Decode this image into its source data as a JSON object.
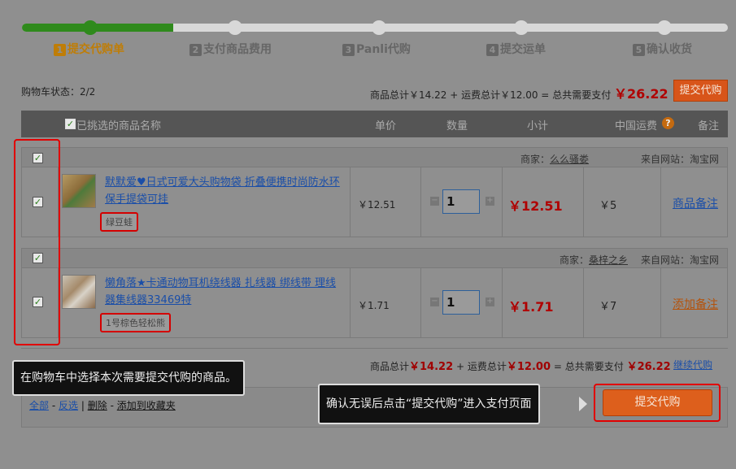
{
  "steps": [
    {
      "num": "1",
      "label": "提交代购单",
      "active": true
    },
    {
      "num": "2",
      "label": "支付商品费用",
      "active": false
    },
    {
      "num": "3",
      "label": "Panli代购",
      "active": false
    },
    {
      "num": "4",
      "label": "提交运单",
      "active": false
    },
    {
      "num": "5",
      "label": "确认收货",
      "active": false
    }
  ],
  "cart_status": "购物车状态：2/2",
  "summary": {
    "goods_label": "商品总计",
    "goods_total": "￥14.22",
    "plus": "+",
    "shipping_label": "运费总计",
    "shipping_total": "￥12.00",
    "eq": "=",
    "pay_label": "总共需要支付",
    "pay_total_top": "￥26.22",
    "pay_total_bottom": "￥26.22"
  },
  "submit_label": "提交代购",
  "table_headers": {
    "name": "已挑选的商品名称",
    "unit_price": "单价",
    "quantity": "数量",
    "subtotal": "小计",
    "cn_shipping": "中国运费",
    "help": "?",
    "note": "备注"
  },
  "items": [
    {
      "seller_label": "商家：",
      "seller": "么么骚娄",
      "site_label": "来自网站：",
      "site": "淘宝网",
      "title": "默默爱♥日式可爱大头购物袋 折叠便携时尚防水环保手提袋可挂",
      "spec": "绿豆蛙",
      "unit_price": "￥12.51",
      "qty": "1",
      "subtotal": "￥12.51",
      "shipping": "￥5",
      "note_action": "商品备注"
    },
    {
      "seller_label": "商家：",
      "seller": "桑梓之乡",
      "site_label": "来自网站：",
      "site": "淘宝网",
      "title": "懒角落★卡通动物耳机绕线器 扎线器 绑线带 理线器集线器33469特",
      "spec": "1号棕色轻松熊",
      "unit_price": "￥1.71",
      "qty": "1",
      "subtotal": "￥1.71",
      "shipping": "￥7",
      "note_action": "添加备注"
    }
  ],
  "continue_label": "继续代购",
  "bottom_actions": {
    "all": "全部",
    "sep1": "-",
    "invert": "反选",
    "sep2": "|",
    "delete": "删除",
    "sep3": "-",
    "favorite": "添加到收藏夹"
  },
  "callouts": {
    "select_tip": "在购物车中选择本次需要提交代购的商品。",
    "submit_tip": "确认无误后点击“提交代购”进入支付页面"
  },
  "colors": {
    "accent_green": "#2f8a1c",
    "accent_orange": "#d8551a",
    "highlight_red": "#e10000",
    "price_red": "#b00000"
  }
}
